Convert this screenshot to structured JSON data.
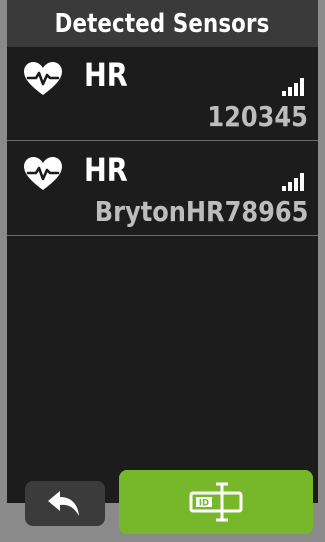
{
  "header": {
    "title": "Detected Sensors"
  },
  "sensors": [
    {
      "type": "HR",
      "id": "120345",
      "icon": "heart-rate-icon",
      "signal_icon": "signal-strength-icon"
    },
    {
      "type": "HR",
      "id": "BrytonHR78965",
      "icon": "heart-rate-icon",
      "signal_icon": "signal-strength-icon"
    }
  ],
  "footer": {
    "back_icon": "back-arrow-icon",
    "id_icon": "sensor-id-icon"
  },
  "colors": {
    "header_bg": "#3a3a3a",
    "screen_bg": "#1c1c1c",
    "accent": "#76b82a",
    "secondary_text": "#bdbdbd"
  }
}
